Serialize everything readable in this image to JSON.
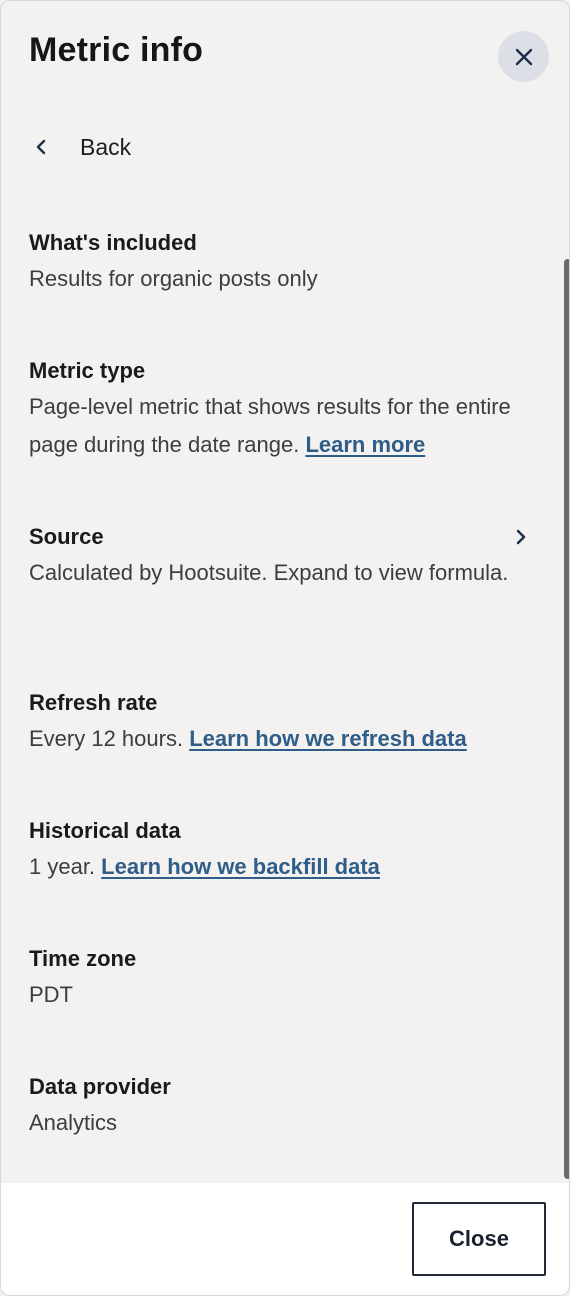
{
  "header": {
    "title": "Metric info",
    "close_icon": "close-icon"
  },
  "nav": {
    "back_label": "Back",
    "back_icon": "chevron-left-icon"
  },
  "sections": {
    "included": {
      "title": "What's included",
      "body": "Results for organic posts only"
    },
    "metric_type": {
      "title": "Metric type",
      "body": "Page-level metric that shows results for the entire page during the date range.",
      "link": "Learn more"
    },
    "source": {
      "title": "Source",
      "body": "Calculated by Hootsuite. Expand to view formula.",
      "icon": "chevron-right-icon"
    },
    "refresh_rate": {
      "title": "Refresh rate",
      "body": "Every 12 hours.",
      "link": "Learn how we refresh data"
    },
    "historical": {
      "title": "Historical data",
      "body": "1 year.",
      "link": "Learn how we backfill data"
    },
    "time_zone": {
      "title": "Time zone",
      "body": "PDT"
    },
    "provider": {
      "title": "Data provider",
      "body": "Analytics"
    }
  },
  "footer": {
    "close_label": "Close"
  },
  "colors": {
    "background": "#f3f2f0",
    "link": "#2f5d8a",
    "close_circle": "#dcdfe6",
    "button_border": "#1e2a38"
  }
}
